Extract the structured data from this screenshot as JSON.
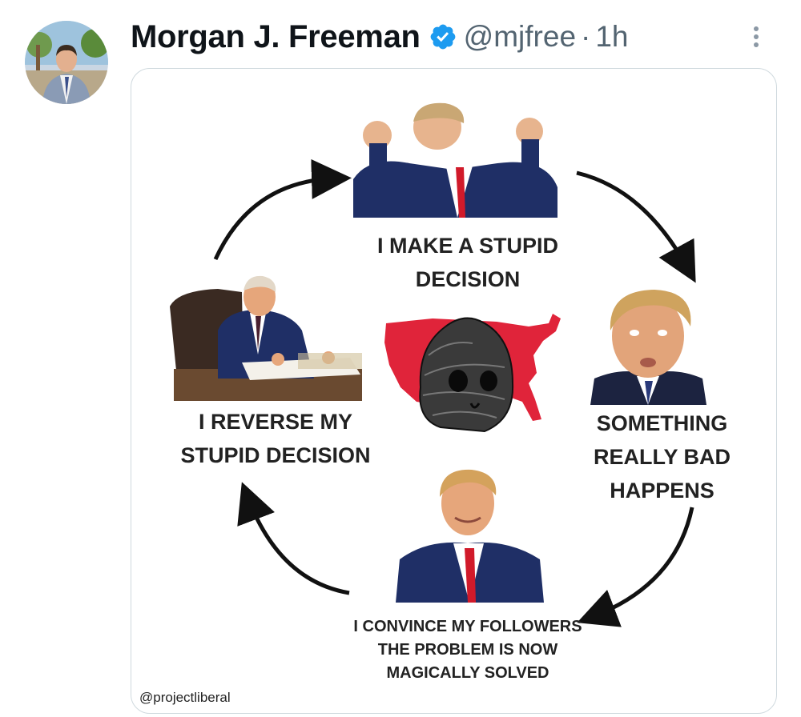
{
  "author": {
    "name": "Morgan J. Freeman",
    "handle": "@mjfree",
    "separator": "·",
    "time": "1h",
    "verified": true
  },
  "media": {
    "cycle_steps": [
      {
        "line1": "I MAKE A STUPID",
        "line2": "DECISION"
      },
      {
        "line1": "SOMETHING",
        "line2": "REALLY BAD",
        "line3": "HAPPENS"
      },
      {
        "line1": "I CONVINCE MY FOLLOWERS",
        "line2": "THE PROBLEM IS NOW",
        "line3": "MAGICALLY SOLVED"
      },
      {
        "line1": "I REVERSE MY",
        "line2": "STUPID DECISION"
      }
    ],
    "credit": "@projectliberal"
  },
  "colors": {
    "verified_badge": "#1d9bf0",
    "map_red": "#e0243a",
    "suit_navy": "#1f2f66",
    "tie_red": "#d11a2a"
  },
  "icons": [
    "verified-badge-icon",
    "more-options-icon"
  ]
}
